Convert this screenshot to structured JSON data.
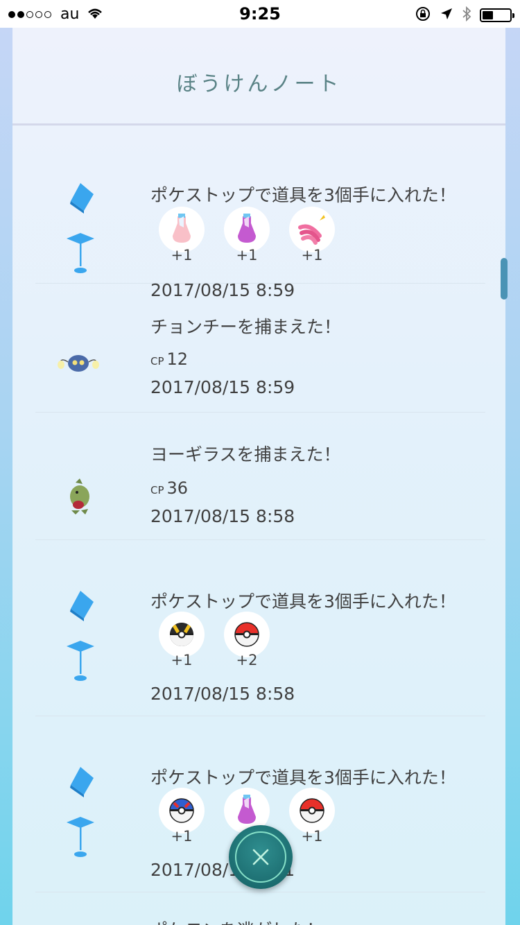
{
  "status_bar": {
    "carrier": "au",
    "time": "9:25",
    "signal_filled": 2,
    "signal_total": 5,
    "battery_level": 0.4
  },
  "header": {
    "title": "ぼうけんノート"
  },
  "entries": [
    {
      "type": "pokestop",
      "title": "ポケストップで道具を3個手に入れた！",
      "items": [
        {
          "icon": "potion-icon",
          "qty": "+1"
        },
        {
          "icon": "super-potion-icon",
          "qty": "+1"
        },
        {
          "icon": "nanab-berry-icon",
          "qty": "+1"
        }
      ],
      "date": "2017/08/15 8:59"
    },
    {
      "type": "catch",
      "title": "チョンチーを捕まえた！",
      "cp_label": "CP",
      "cp": "12",
      "icon": "chinchou-icon",
      "date": "2017/08/15 8:59"
    },
    {
      "type": "catch",
      "title": "ヨーギラスを捕まえた！",
      "cp_label": "CP",
      "cp": "36",
      "icon": "larvitar-icon",
      "date": "2017/08/15 8:58"
    },
    {
      "type": "pokestop",
      "title": "ポケストップで道具を3個手に入れた！",
      "items": [
        {
          "icon": "ultra-ball-icon",
          "qty": "+1"
        },
        {
          "icon": "poke-ball-icon",
          "qty": "+2"
        }
      ],
      "date": "2017/08/15 8:58"
    },
    {
      "type": "pokestop",
      "title": "ポケストップで道具を3個手に入れた！",
      "items": [
        {
          "icon": "great-ball-icon",
          "qty": "+1"
        },
        {
          "icon": "super-potion-icon",
          "qty": "+1"
        },
        {
          "icon": "poke-ball-icon",
          "qty": "+1"
        }
      ],
      "date": "2017/08/15 8:51"
    }
  ],
  "partial_entry_title": "ポケモンを逃がした！",
  "colors": {
    "title_text": "#5a8386",
    "body_text": "#404040",
    "pokestop_blue": "#3aa6ee",
    "close_button": "#1c6d70"
  }
}
